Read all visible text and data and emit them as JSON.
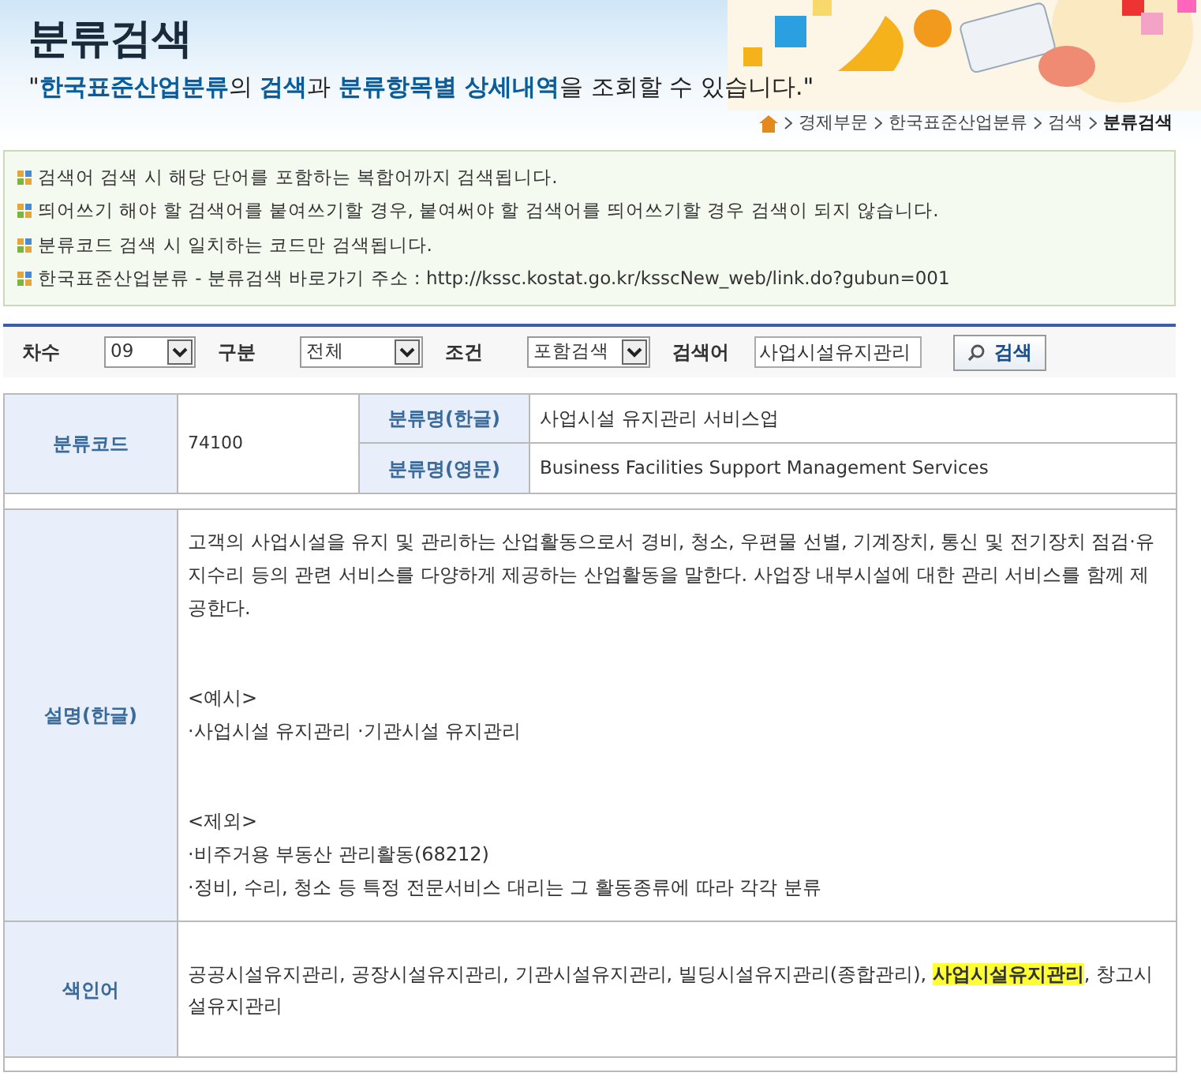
{
  "header": {
    "title": "분류검색",
    "subtitle": "\"**한국표준산업분류**의 **검색**과 **분류항목별 상세내역**을 조회할 수 있습니다.\"",
    "breadcrumb": [
      "경제부문",
      "한국표준산업분류",
      "검색",
      "분류검색"
    ]
  },
  "notices": [
    "검색어 검색 시 해당 단어를 포함하는 복합어까지 검색됩니다.",
    "띄어쓰기 해야 할 검색어를 붙여쓰기할 경우, 붙여써야 할 검색어를 띄어쓰기할 경우 검색이 되지 않습니다.",
    "분류코드 검색 시 일치하는 코드만 검색됩니다.",
    "한국표준산업분류 - 분류검색 바로가기 주소 : http://kssc.kostat.go.kr/ksscNew_web/link.do?gubun=001"
  ],
  "search": {
    "fields": [
      {
        "kind": "select",
        "label": "차수",
        "value": "09"
      },
      {
        "kind": "select",
        "label": "구분",
        "value": "전체"
      },
      {
        "kind": "select",
        "label": "조건",
        "value": "포함검색"
      },
      {
        "kind": "input",
        "label": "검색어",
        "value": "사업시설유지관리"
      }
    ],
    "button": "검색"
  },
  "detail": {
    "code_label": "분류코드",
    "code": "74100",
    "name_ko_label": "분류명(한글)",
    "name_ko": "사업시설 유지관리 서비스업",
    "name_en_label": "분류명(영문)",
    "name_en": "Business Facilities Support Management Services",
    "description_label": "설명(한글)",
    "description": [
      [
        "고객의 사업시설을 유지 및 관리하는 산업활동으로서 경비, 청소, 우편물 선별, 기계장치, 통신 및 전기장치 점검·유지수리 등의 관련 서비스를 다양하게 제공하는 산업활동을 말한다. 사업장 내부시설에 대한 관리 서비스를 함께 제공한다."
      ],
      [
        "<예시>",
        "·사업시설 유지관리 ·기관시설 유지관리"
      ],
      [
        "<제외>",
        "·비주거용 부동산 관리활동(68212)",
        "·정비, 수리, 청소 등 특정 전문서비스 대리는 그 활동종류에 따라 각각 분류"
      ]
    ],
    "index_label": "색인어",
    "index_terms": "공공시설유지관리, 공장시설유지관리, 기관시설유지관리, 빌딩시설유지관리(종합관리), **사업시설유지관리**, 창고시설유지관리"
  }
}
